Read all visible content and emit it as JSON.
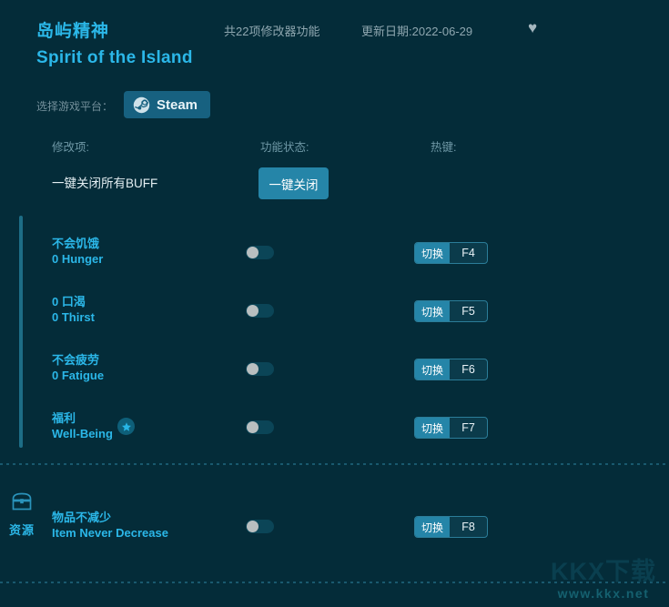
{
  "header": {
    "title_cn": "岛屿精神",
    "title_en": "Spirit of the Island",
    "feature_count": "共22项修改器功能",
    "update_date": "更新日期:2022-06-29",
    "favorite_icon": "heart-icon"
  },
  "platform": {
    "label": "选择游戏平台：",
    "selected": "Steam",
    "icon": "steam-icon"
  },
  "columns": {
    "option": "修改项:",
    "status": "功能状态:",
    "hotkey": "热键:"
  },
  "all_off": {
    "label": "一键关闭所有BUFF",
    "button": "一键关闭"
  },
  "groups": [
    {
      "icon": "",
      "icon_name": "",
      "label": "",
      "rows": [
        {
          "cn": "不会饥饿",
          "en": "0 Hunger",
          "toggle_state": "off",
          "hotkey_action": "切换",
          "hotkey_key": "F4",
          "starred": false
        },
        {
          "cn": "0 口渴",
          "en": "0 Thirst",
          "toggle_state": "off",
          "hotkey_action": "切换",
          "hotkey_key": "F5",
          "starred": false
        },
        {
          "cn": "不会疲劳",
          "en": "0 Fatigue",
          "toggle_state": "off",
          "hotkey_action": "切换",
          "hotkey_key": "F6",
          "starred": false
        },
        {
          "cn": "福利",
          "en": "Well-Being",
          "toggle_state": "off",
          "hotkey_action": "切换",
          "hotkey_key": "F7",
          "starred": true
        }
      ]
    },
    {
      "icon_name": "treasure-chest-icon",
      "label": "资源",
      "rows": [
        {
          "cn": "物品不减少",
          "en": "Item Never Decrease",
          "toggle_state": "off",
          "hotkey_action": "切换",
          "hotkey_key": "F8",
          "starred": false
        }
      ]
    }
  ],
  "watermark": {
    "main": "KKX下载",
    "sub": "www.kkx.net"
  },
  "colors": {
    "background": "#042c39",
    "accent": "#2bb7e8",
    "button": "#2585a8",
    "platform_button": "#176180",
    "group_bar": "#1d6d86",
    "muted_text": "#8fa7b0",
    "toggle_track": "#0b4557",
    "toggle_knob": "#b9bfc0"
  }
}
